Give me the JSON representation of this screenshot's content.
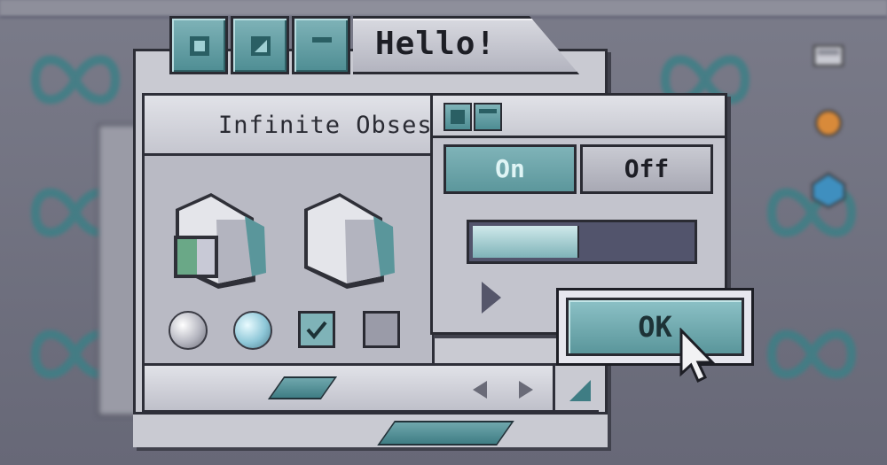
{
  "window": {
    "title": "Hello!",
    "panel_title": "Infinite Obses"
  },
  "controls": {
    "on_label": "On",
    "off_label": "Off",
    "progress": 0.48,
    "ok_label": "OK"
  },
  "colors": {
    "accent": "#5a969b",
    "accent_light": "#8cc1c6",
    "chrome": "#c9cad2",
    "desktop": "#6d6e7c",
    "border": "#2a2b33"
  },
  "icons": {
    "title_buttons": [
      "close-icon",
      "zoom-icon",
      "collapse-icon"
    ],
    "folders": [
      "finder-folder-icon",
      "folder-icon"
    ],
    "controls": [
      "radio-off-icon",
      "radio-on-icon",
      "checkbox-checked-icon",
      "checkbox-unchecked-icon"
    ]
  }
}
